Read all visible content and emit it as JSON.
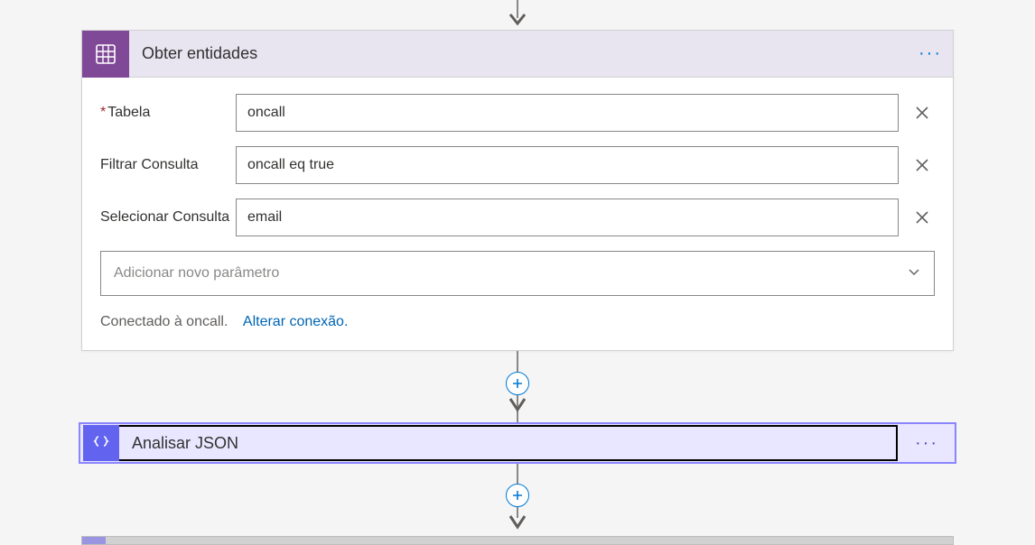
{
  "card1": {
    "title": "Obter entidades",
    "fields": {
      "table": {
        "label": "Tabela",
        "value": "oncall"
      },
      "filter": {
        "label": "Filtrar Consulta",
        "value": "oncall eq true"
      },
      "select": {
        "label": "Selecionar Consulta",
        "value": "email"
      }
    },
    "paramPlaceholder": "Adicionar novo parâmetro",
    "connectedText": "Conectado à oncall.",
    "changeConn": "Alterar conexão."
  },
  "card2": {
    "title": "Analisar JSON"
  }
}
